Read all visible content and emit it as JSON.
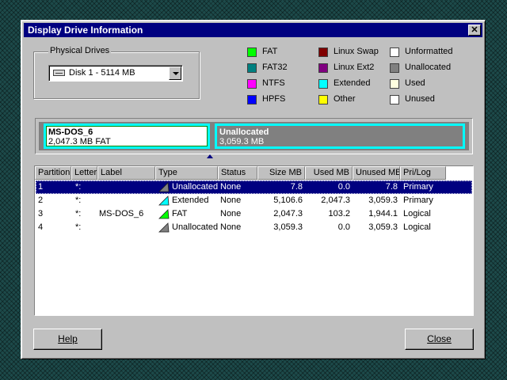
{
  "window": {
    "title": "Display Drive Information"
  },
  "physical_drives": {
    "label": "Physical Drives",
    "selected": "Disk 1 - 5114  MB",
    "icon": "hard-drive-icon"
  },
  "legend": [
    {
      "label": "FAT",
      "color": "#00ff00"
    },
    {
      "label": "FAT32",
      "color": "#008080"
    },
    {
      "label": "NTFS",
      "color": "#ff00ff"
    },
    {
      "label": "HPFS",
      "color": "#0000ff"
    },
    {
      "label": "Linux Swap",
      "color": "#800000"
    },
    {
      "label": "Linux Ext2",
      "color": "#800080"
    },
    {
      "label": "Extended",
      "color": "#00ffff"
    },
    {
      "label": "Other",
      "color": "#ffff00"
    },
    {
      "label": "Unformatted",
      "color": "#ffffff"
    },
    {
      "label": "Unallocated",
      "color": "#808080"
    },
    {
      "label": "Used",
      "color": "#ffffe0"
    },
    {
      "label": "Unused",
      "color": "#ffffff"
    }
  ],
  "disk_map": [
    {
      "name": "MS-DOS_6",
      "detail": "2,047.3 MB FAT"
    },
    {
      "name": "Unallocated",
      "detail": "3,059.3 MB"
    }
  ],
  "table": {
    "columns": [
      "Partition",
      "Letter",
      "Label",
      "Type",
      "Status",
      "Size MB",
      "Used MB",
      "Unused MB",
      "Pri/Log"
    ],
    "rows": [
      {
        "partition": "1",
        "letter": "*:",
        "label": "",
        "type": "Unallocated",
        "type_color": "#808080",
        "status": "None",
        "size": "7.8",
        "used": "0.0",
        "unused": "7.8",
        "prilog": "Primary",
        "selected": true
      },
      {
        "partition": "2",
        "letter": "*:",
        "label": "",
        "type": "Extended",
        "type_color": "#00ffff",
        "status": "None",
        "size": "5,106.6",
        "used": "2,047.3",
        "unused": "3,059.3",
        "prilog": "Primary",
        "selected": false
      },
      {
        "partition": "3",
        "letter": "*:",
        "label": "MS-DOS_6",
        "type": "FAT",
        "type_color": "#00ff00",
        "status": "None",
        "size": "2,047.3",
        "used": "103.2",
        "unused": "1,944.1",
        "prilog": "Logical",
        "selected": false
      },
      {
        "partition": "4",
        "letter": "*:",
        "label": "",
        "type": "Unallocated",
        "type_color": "#808080",
        "status": "None",
        "size": "3,059.3",
        "used": "0.0",
        "unused": "3,059.3",
        "prilog": "Logical",
        "selected": false
      }
    ]
  },
  "buttons": {
    "help": "Help",
    "close": "Close"
  }
}
